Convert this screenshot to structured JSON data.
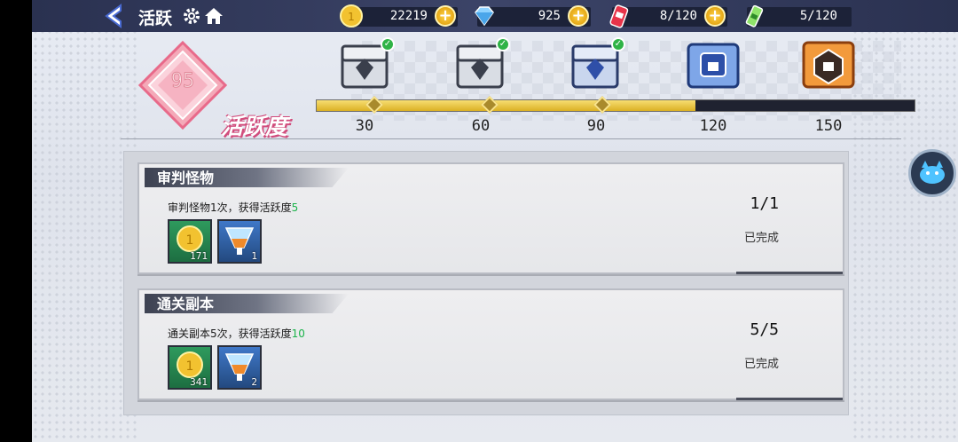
{
  "header": {
    "title": "活跃",
    "resources": [
      {
        "icon": "coin-icon",
        "value": "22219",
        "has_plus": true
      },
      {
        "icon": "diamond-icon",
        "value": "925",
        "has_plus": true
      },
      {
        "icon": "energy-drink-icon",
        "value": "8/120",
        "has_plus": true
      },
      {
        "icon": "stamina-pack-icon",
        "value": "5/120",
        "has_plus": false
      }
    ]
  },
  "activity": {
    "score": "95",
    "label": "活跃度",
    "current": 95,
    "max": 150,
    "milestones": [
      {
        "value": "30",
        "claimed": true
      },
      {
        "value": "60",
        "claimed": true
      },
      {
        "value": "90",
        "claimed": true
      },
      {
        "value": "120",
        "claimed": false
      },
      {
        "value": "150",
        "claimed": false
      }
    ]
  },
  "tasks": [
    {
      "name": "审判怪物",
      "desc": "审判怪物1次，获得活跃度",
      "points": "5",
      "progress": "1/1",
      "status": "已完成",
      "rewards": [
        {
          "icon": "gold-coin-icon",
          "qty": "171"
        },
        {
          "icon": "exp-drink-icon",
          "qty": "1"
        }
      ]
    },
    {
      "name": "通关副本",
      "desc": "通关副本5次，获得活跃度",
      "points": "10",
      "progress": "5/5",
      "status": "已完成",
      "rewards": [
        {
          "icon": "gold-coin-icon",
          "qty": "341"
        },
        {
          "icon": "exp-drink-icon",
          "qty": "2"
        }
      ]
    }
  ],
  "colors": {
    "topbar": "#2a3150",
    "progress_fill": "#f0c94a",
    "complete_green": "#1bb34a",
    "badge_pink": "#e86a8a"
  }
}
